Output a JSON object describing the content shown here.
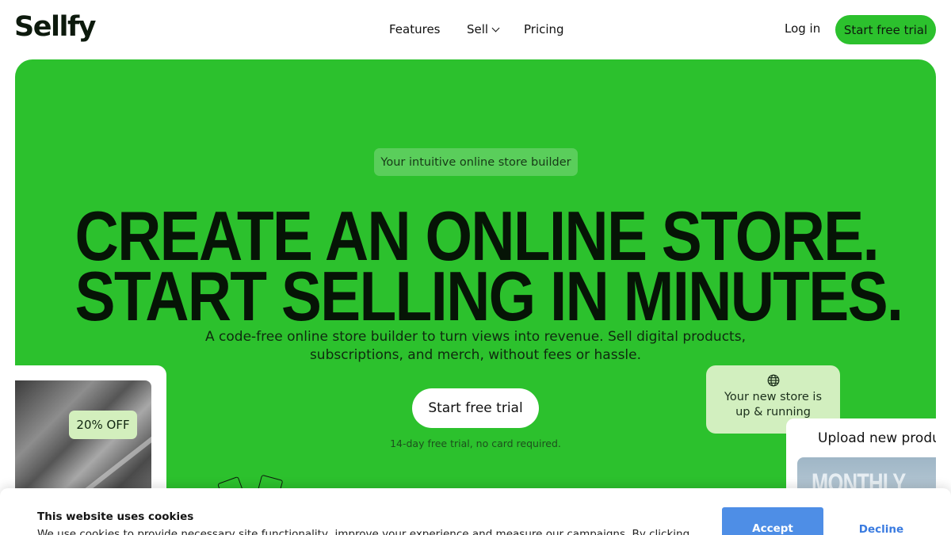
{
  "header": {
    "logo": "Sellfy",
    "nav": [
      {
        "label": "Features"
      },
      {
        "label": "Sell"
      },
      {
        "label": "Pricing"
      }
    ],
    "login_label": "Log in",
    "cta_label": "Start free trial"
  },
  "hero": {
    "tagline": "Your intuitive online store builder",
    "headline_line1": "CREATE AN ONLINE STORE.",
    "headline_line2": "START SELLING IN MINUTES.",
    "subtitle": "A code-free online store builder to turn views into revenue. Sell digital products, subscriptions, and merch, without fees or hassle.",
    "cta_label": "Start free trial",
    "trial_note": "14-day free trial, no card required.",
    "background_color": "#2cc12d"
  },
  "cards": {
    "discount_badge": "20% OFF",
    "notification_text": "Your new store is up & running",
    "upload_label": "Upload new product",
    "product_image_text": "MONTHLY"
  },
  "cookie_banner": {
    "title": "This website uses cookies",
    "text": "We use cookies to provide necessary site functionality, improve your experience and measure our campaigns. By clicking",
    "accept_label": "Accept",
    "decline_label": "Decline",
    "accept_color": "#4e8ee6"
  },
  "icons": [
    "chevron-down-icon",
    "globe-icon"
  ]
}
